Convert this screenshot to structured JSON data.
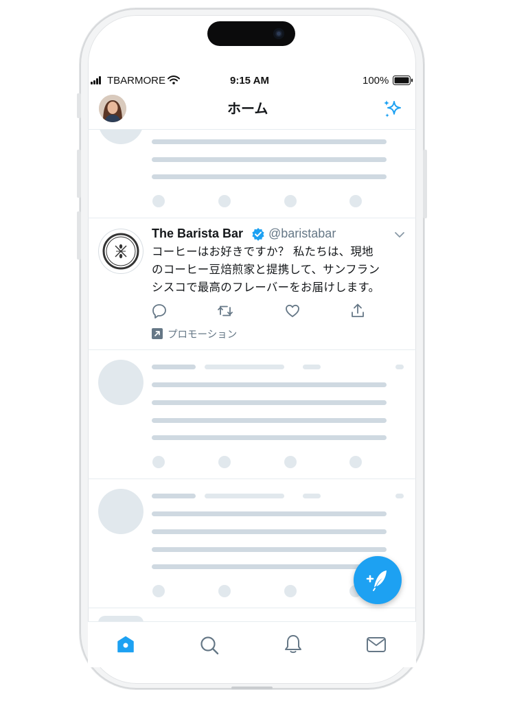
{
  "status_bar": {
    "carrier": "TBARMORE",
    "time": "9:15 AM",
    "battery": "100%"
  },
  "header": {
    "title": "ホーム"
  },
  "promoted_tweet": {
    "name": "The Barista Bar",
    "handle": "@baristabar",
    "verified": true,
    "lines": [
      "コーヒーはお好きですか？ 私たちは、現地",
      "のコーヒー豆焙煎家と提携して、サンフラン",
      "シスコで最高のフレーバーをお届けします。"
    ],
    "promoted_label": "プロモーション"
  },
  "bottom_nav": {
    "items": [
      "home-icon",
      "search-icon",
      "notifications-icon",
      "messages-icon"
    ],
    "active": "home-icon"
  },
  "colors": {
    "accent": "#1da1f2",
    "text": "#14171a",
    "secondary": "#657786",
    "skeleton": "#cfd9e1",
    "skeleton_light": "#e1e8ed"
  }
}
